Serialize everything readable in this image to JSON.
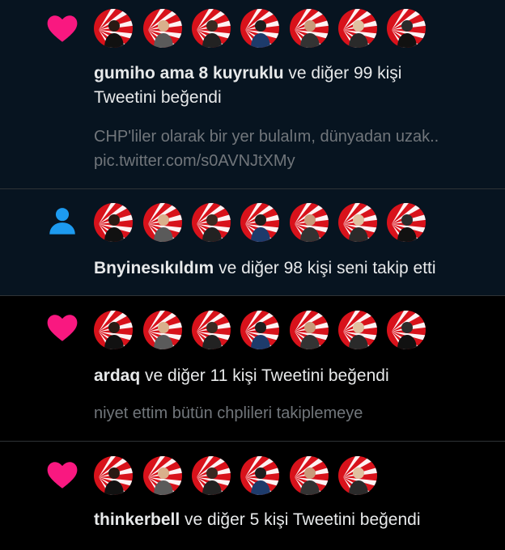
{
  "colors": {
    "heart": "#f91880",
    "person": "#1d9bf0",
    "avatar_red": "#d8121b",
    "avatar_white": "#ffffff",
    "text_primary": "#e7e9ea",
    "text_secondary": "#71767b"
  },
  "notifications": [
    {
      "type": "like",
      "icon": "heart-icon",
      "unread": true,
      "user": "gumiho ama 8 kuyruklu",
      "action": "ve diğer 99 kişi",
      "action_line2": "Tweetini beğendi",
      "preview_line1": "CHP'liler olarak bir yer bulalım, dünyadan uzak..",
      "preview_line2": "pic.twitter.com/s0AVNJtXMy",
      "avatar_count": 7
    },
    {
      "type": "follow",
      "icon": "person-icon",
      "unread": true,
      "user": "Bnyinesıkıldım",
      "action": "ve diğer 98 kişi seni takip etti",
      "avatar_count": 7
    },
    {
      "type": "like",
      "icon": "heart-icon",
      "unread": false,
      "user": "ardaq",
      "action": "ve diğer 11 kişi Tweetini beğendi",
      "preview_line1": "niyet ettim bütün chplileri takiplemeye",
      "avatar_count": 7
    },
    {
      "type": "like",
      "icon": "heart-icon",
      "unread": false,
      "user": "thinkerbell",
      "action": "ve diğer 5 kişi Tweetini beğendi",
      "avatar_count": 6
    }
  ]
}
